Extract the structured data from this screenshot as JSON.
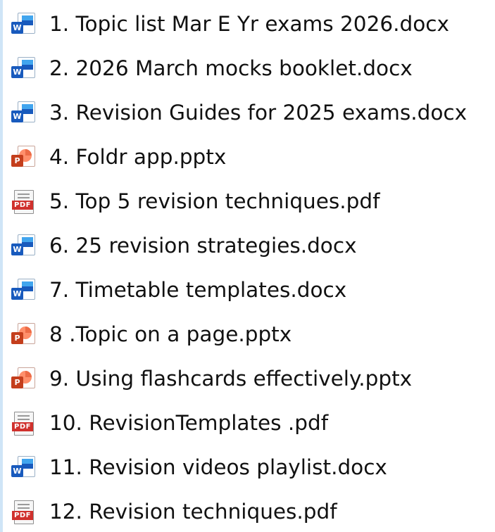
{
  "files": [
    {
      "name": "1. Topic list Mar E Yr exams 2026.docx",
      "icon": "word-document-icon",
      "badge": "W"
    },
    {
      "name": "2. 2026 March mocks booklet.docx",
      "icon": "word-document-icon",
      "badge": "W"
    },
    {
      "name": "3. Revision Guides for 2025 exams.docx",
      "icon": "word-document-icon",
      "badge": "W"
    },
    {
      "name": "4. Foldr app.pptx",
      "icon": "powerpoint-presentation-icon",
      "badge": "P"
    },
    {
      "name": "5. Top 5 revision techniques.pdf",
      "icon": "pdf-document-icon",
      "badge": "PDF"
    },
    {
      "name": "6. 25 revision strategies.docx",
      "icon": "word-document-icon",
      "badge": "W"
    },
    {
      "name": "7. Timetable templates.docx",
      "icon": "word-document-icon",
      "badge": "W"
    },
    {
      "name": "8 .Topic on a page.pptx",
      "icon": "powerpoint-presentation-icon",
      "badge": "P"
    },
    {
      "name": "9. Using flashcards effectively.pptx",
      "icon": "powerpoint-presentation-icon",
      "badge": "P"
    },
    {
      "name": "10. RevisionTemplates .pdf",
      "icon": "pdf-document-icon",
      "badge": "PDF"
    },
    {
      "name": "11. Revision videos playlist.docx",
      "icon": "word-document-icon",
      "badge": "W"
    },
    {
      "name": "12. Revision techniques.pdf",
      "icon": "pdf-document-icon",
      "badge": "PDF"
    }
  ],
  "colors": {
    "word_blue": "#185abd",
    "powerpoint_orange": "#c43e1c",
    "pdf_red": "#d0312d",
    "selection_strip": "#cfe5f7"
  }
}
